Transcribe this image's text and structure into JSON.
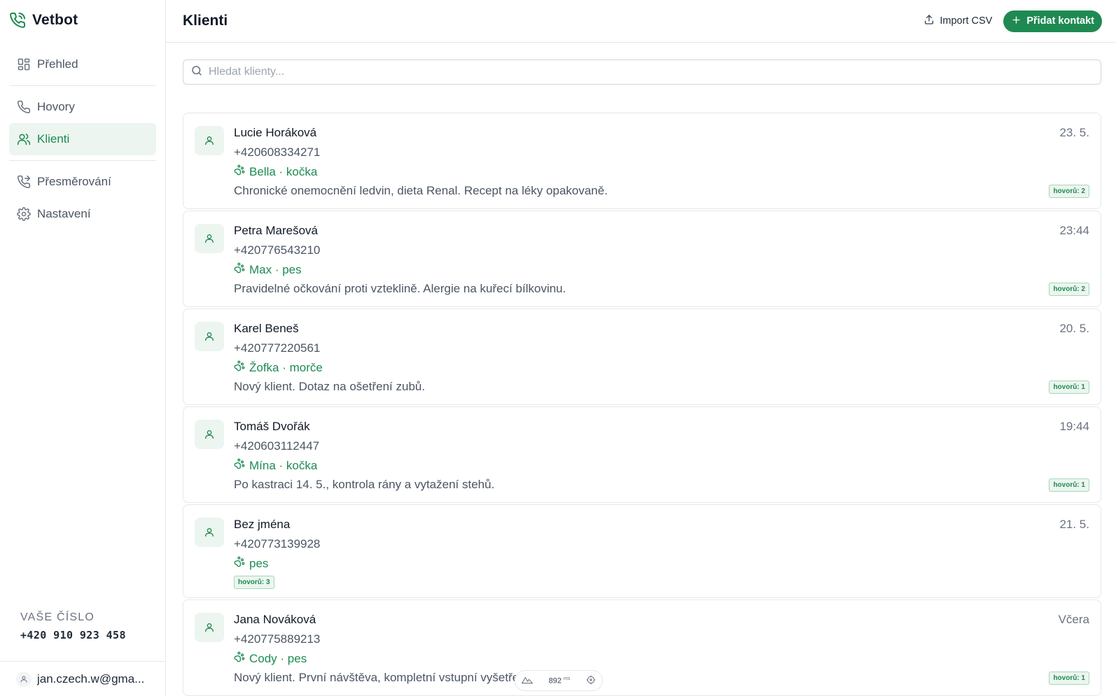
{
  "app": {
    "name": "Vetbot"
  },
  "sidebar": {
    "items": [
      {
        "label": "Přehled",
        "icon": "dashboard-icon"
      },
      {
        "label": "Hovory",
        "icon": "phone-icon"
      },
      {
        "label": "Klienti",
        "icon": "users-icon",
        "active": true
      },
      {
        "label": "Přesměrování",
        "icon": "phone-forward-icon"
      },
      {
        "label": "Nastavení",
        "icon": "gear-icon"
      }
    ],
    "your_number_label": "VAŠE ČÍSLO",
    "your_number": "+420 910 923 458",
    "user_email": "jan.czech.w@gma..."
  },
  "header": {
    "title": "Klienti",
    "import_label": "Import CSV",
    "add_label": "Přidat kontakt"
  },
  "search": {
    "placeholder": "Hledat klienty..."
  },
  "clients": [
    {
      "name": "Lucie Horáková",
      "phone": "+420608334271",
      "pet": "Bella · kočka",
      "note": "Chronické onemocnění ledvin, dieta Renal. Recept na léky opakovaně.",
      "date": "23. 5.",
      "calls": "hovorů: 2"
    },
    {
      "name": "Petra Marešová",
      "phone": "+420776543210",
      "pet": "Max · pes",
      "note": "Pravidelné očkování proti vzteklině. Alergie na kuřecí bílkovinu.",
      "date": "23:44",
      "calls": "hovorů: 2"
    },
    {
      "name": "Karel Beneš",
      "phone": "+420777220561",
      "pet": "Žofka · morče",
      "note": "Nový klient. Dotaz na ošetření zubů.",
      "date": "20. 5.",
      "calls": "hovorů: 1"
    },
    {
      "name": "Tomáš Dvořák",
      "phone": "+420603112447",
      "pet": "Mína · kočka",
      "note": "Po kastraci 14. 5., kontrola rány a vytažení stehů.",
      "date": "19:44",
      "calls": "hovorů: 1"
    },
    {
      "name": "Bez jména",
      "phone": "+420773139928",
      "pet": "pes",
      "note": "",
      "date": "21. 5.",
      "calls": "hovorů: 3"
    },
    {
      "name": "Jana Nováková",
      "phone": "+420775889213",
      "pet": "Cody · pes",
      "note": "Nový klient. První návštěva, kompletní vstupní vyšetření.",
      "date": "Včera",
      "calls": "hovorů: 1"
    }
  ],
  "perf": {
    "value": "892",
    "unit": "ms"
  },
  "colors": {
    "accent": "#1e8a52",
    "accent_light": "#ecf5ef",
    "border": "#e5e7eb"
  }
}
